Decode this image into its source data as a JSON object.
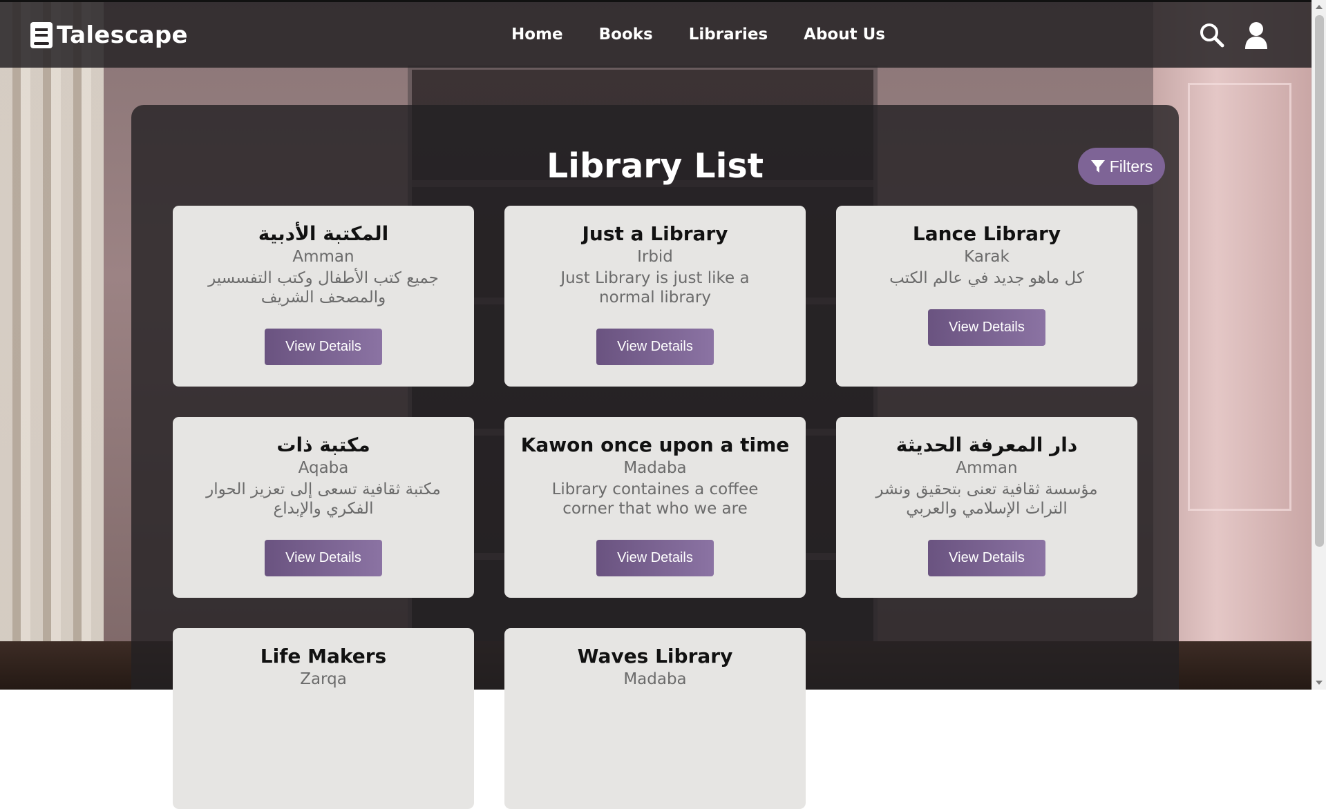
{
  "nav": {
    "brand": "Talescape",
    "links": [
      "Home",
      "Books",
      "Libraries",
      "About Us"
    ]
  },
  "page": {
    "title": "Library List",
    "filters_label": "Filters"
  },
  "libraries": [
    {
      "name": "المكتبة الأدبية",
      "city": "Amman",
      "description": "جميع كتب الأطفال وكتب التفسسير والمصحف الشريف",
      "button": "View Details"
    },
    {
      "name": "Just a Library",
      "city": "Irbid",
      "description": "Just Library is just like a normal library",
      "button": "View Details"
    },
    {
      "name": "Lance Library",
      "city": "Karak",
      "description": "كل ماهو جديد في عالم الكتب",
      "button": "View Details"
    },
    {
      "name": "مكتبة ذات",
      "city": "Aqaba",
      "description": "مكتبة ثقافية تسعى إلى تعزيز الحوار الفكري والإبداع",
      "button": "View Details"
    },
    {
      "name": "Kawon once upon a time",
      "city": "Madaba",
      "description": "Library containes a coffee corner that who we are",
      "button": "View Details"
    },
    {
      "name": "دار المعرفة الحديثة",
      "city": "Amman",
      "description": "مؤسسة ثقافية تعنى بتحقيق ونشر التراث الإسلامي والعربي",
      "button": "View Details"
    },
    {
      "name": "Life Makers",
      "city": "Zarqa",
      "description": "",
      "button": ""
    },
    {
      "name": "Waves Library",
      "city": "Madaba",
      "description": "",
      "button": ""
    }
  ],
  "colors": {
    "navbar": "#282426",
    "accent": "#7e6496",
    "card": "#e6e5e3",
    "panel": "#232123"
  },
  "icons": {
    "brand": "book-icon",
    "search": "search-icon",
    "user": "user-icon",
    "filter": "filter-icon"
  }
}
